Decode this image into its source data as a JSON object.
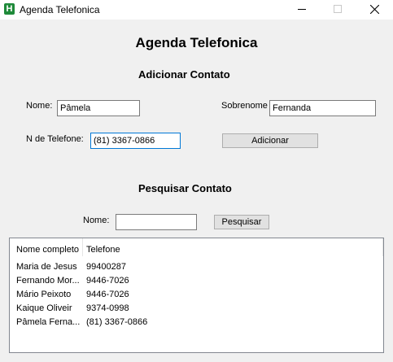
{
  "window": {
    "title": "Agenda Telefonica",
    "app_icon_letter": "H",
    "app_icon_color": "#1f8a3a",
    "controls": [
      "minimize-icon",
      "maximize-icon",
      "close-icon"
    ]
  },
  "heading": "Agenda Telefonica",
  "add_section": {
    "title": "Adicionar Contato",
    "name_label": "Nome:",
    "name_value": "Pâmela",
    "surname_label": "Sobrenome",
    "surname_value": "Fernanda",
    "phone_label": "N de Telefone:",
    "phone_value": "(81) 3367-0866",
    "add_button": "Adicionar"
  },
  "search_section": {
    "title": "Pesquisar Contato",
    "name_label": "Nome:",
    "name_value": "",
    "search_button": "Pesquisar"
  },
  "list": {
    "columns": [
      "Nome completo",
      "Telefone"
    ],
    "rows": [
      {
        "name": "Maria de Jesus",
        "phone": "99400287"
      },
      {
        "name": "Fernando Mor...",
        "phone": "9446-7026"
      },
      {
        "name": "Mário Peixoto",
        "phone": "9446-7026"
      },
      {
        "name": "Kaique Oliveir",
        "phone": "9374-0998"
      },
      {
        "name": "Pâmela Ferna...",
        "phone": "(81) 3367-0866"
      }
    ]
  },
  "colors": {
    "background": "#f0f0f0",
    "focus_border": "#0078d7",
    "button_face": "#e1e1e1"
  }
}
